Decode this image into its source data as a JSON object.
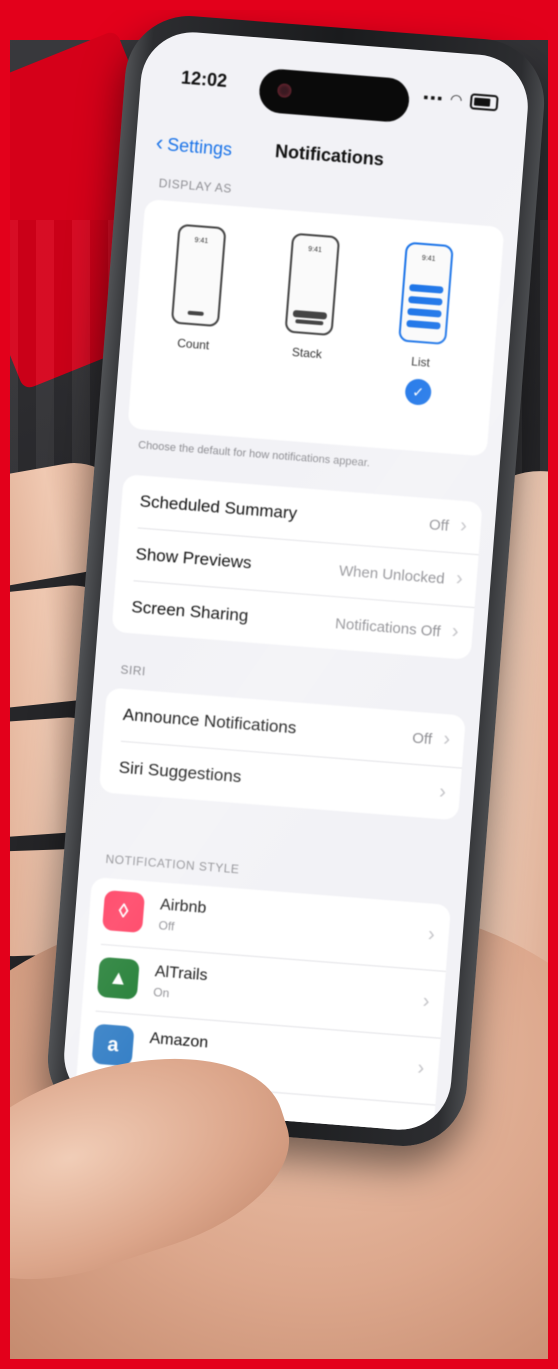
{
  "status_bar": {
    "time": "12:02"
  },
  "nav": {
    "back_label": "Settings",
    "title": "Notifications"
  },
  "display_as": {
    "section_label": "Display As",
    "modes": [
      {
        "label": "Count",
        "selected": false
      },
      {
        "label": "Stack",
        "selected": false
      },
      {
        "label": "List",
        "selected": true
      }
    ],
    "footnote": "Choose the default for how notifications appear."
  },
  "summary_rows": [
    {
      "label": "Scheduled Summary",
      "value": "Off"
    },
    {
      "label": "Show Previews",
      "value": "When Unlocked"
    },
    {
      "label": "Screen Sharing",
      "value": "Notifications Off"
    }
  ],
  "siri": {
    "section_label": "Siri",
    "rows": [
      {
        "label": "Announce Notifications",
        "value": "Off"
      },
      {
        "label": "Siri Suggestions",
        "value": ""
      }
    ]
  },
  "apps": {
    "section_label": "Notification Style",
    "items": [
      {
        "name": "Airbnb",
        "sub": "Off",
        "icon": "airbnb-icon",
        "color": "#ff385c"
      },
      {
        "name": "AlTrails",
        "sub": "On",
        "icon": "alltrails-icon",
        "color": "#1b7a2e"
      },
      {
        "name": "Amazon",
        "sub": "",
        "icon": "amazon-icon",
        "color": "#2e7bc4"
      }
    ]
  },
  "colors": {
    "frame_red": "#e3001b",
    "accent_blue": "#1a73e8"
  }
}
